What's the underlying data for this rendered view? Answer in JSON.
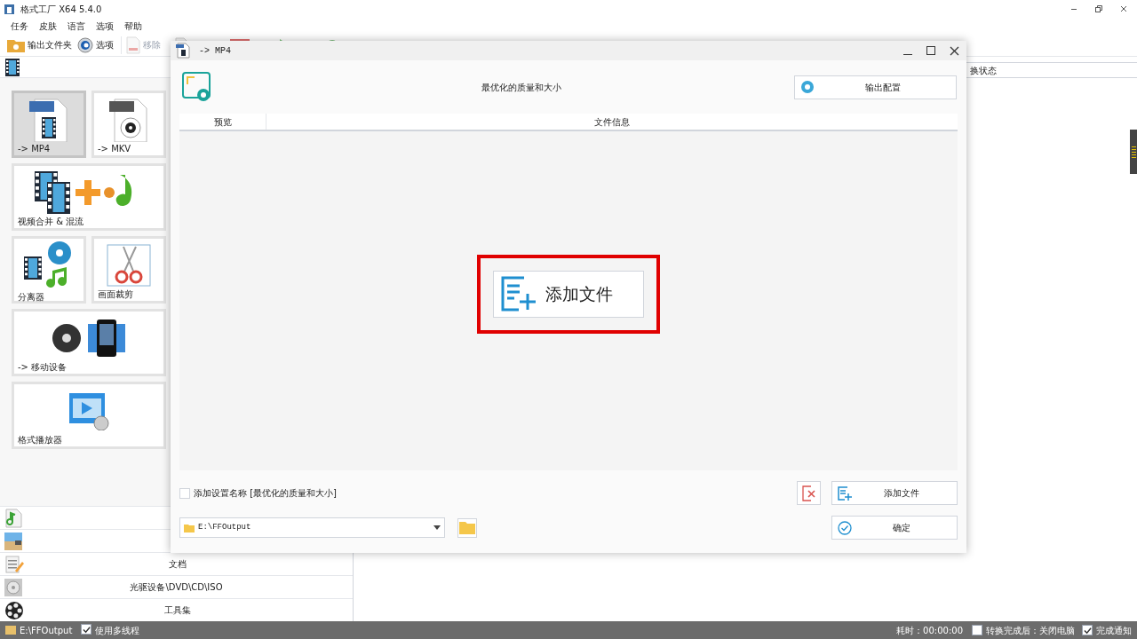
{
  "window": {
    "title": "格式工厂 X64 5.4.0"
  },
  "menu": [
    "任务",
    "皮肤",
    "语言",
    "选项",
    "帮助"
  ],
  "toolbar": [
    {
      "label": "输出文件夹",
      "kind": "folder",
      "disabled": false
    },
    {
      "label": "选项",
      "kind": "options",
      "disabled": false
    },
    {
      "label": "移除",
      "kind": "remove",
      "disabled": true
    }
  ],
  "tiles": [
    {
      "label": "-> MP4",
      "kind": "mp4",
      "selected": true,
      "wide": false
    },
    {
      "label": "-> MKV",
      "kind": "mkv",
      "selected": false,
      "wide": false
    },
    {
      "label": "视频合并 & 混流",
      "kind": "merge",
      "selected": false,
      "wide": true
    },
    {
      "label": "分离器",
      "kind": "splitter",
      "selected": false,
      "wide": false
    },
    {
      "label": "画面裁剪",
      "kind": "crop",
      "selected": false,
      "wide": false
    },
    {
      "label": "-> 移动设备",
      "kind": "mobile",
      "selected": false,
      "wide": true
    },
    {
      "label": "格式播放器",
      "kind": "player",
      "selected": false,
      "wide": true
    }
  ],
  "categories": [
    {
      "kind": "audio"
    },
    {
      "kind": "picture"
    },
    {
      "label": "文档",
      "kind": "document"
    },
    {
      "label": "光驱设备\\DVD\\CD\\ISO",
      "kind": "disc"
    },
    {
      "label": "工具集",
      "kind": "tools"
    }
  ],
  "task_list": {
    "column_1": "换状态"
  },
  "dialog": {
    "title": "-> MP4",
    "profile": "最优化的质量和大小",
    "config_button": "输出配置",
    "columns": [
      "预览",
      "文件信息"
    ],
    "center_button": "添加文件",
    "add_name": {
      "label": "添加设置名称 [最优化的质量和大小]",
      "checked": false
    },
    "output_path": "E:\\FFOutput",
    "add_button": "添加文件",
    "ok_button": "确定"
  },
  "status_bar": {
    "path": "E:\\FFOutput",
    "multithread": {
      "label": "使用多线程",
      "checked": true
    },
    "elapsed": "耗时：00:00:00",
    "after": {
      "label": "转换完成后：关闭电脑",
      "checked": false
    },
    "notify": {
      "label": "完成通知",
      "checked": true
    }
  }
}
